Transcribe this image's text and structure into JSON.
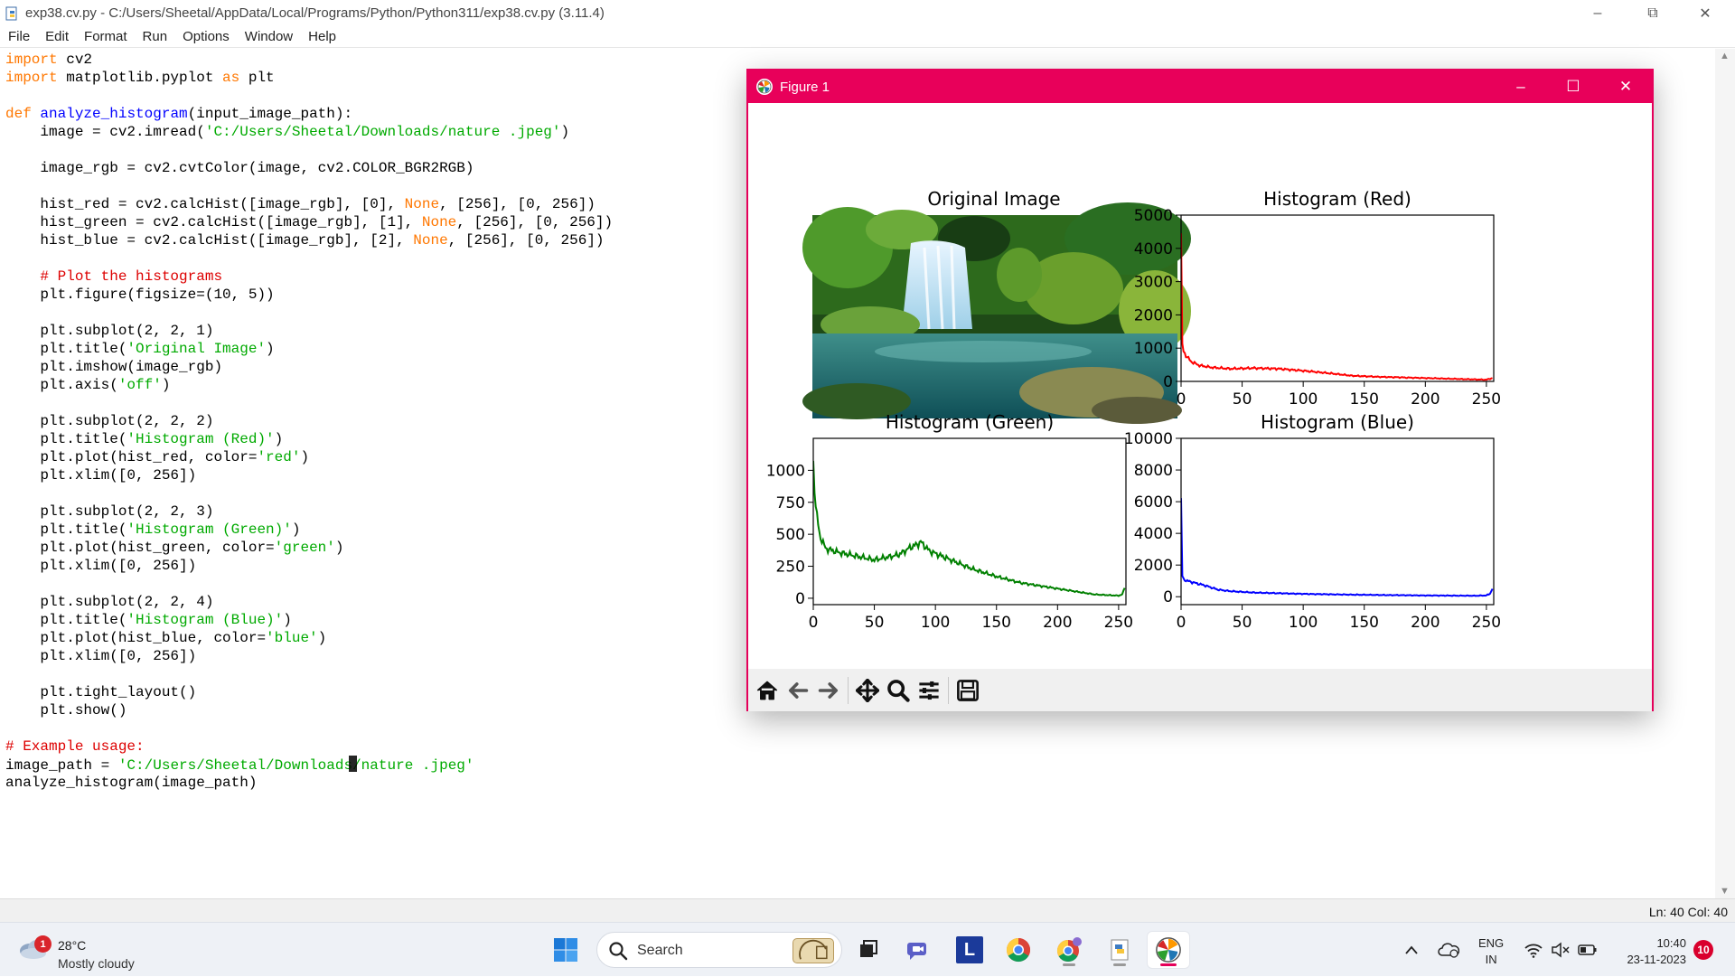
{
  "idle": {
    "title": "exp38.cv.py - C:/Users/Sheetal/AppData/Local/Programs/Python/Python311/exp38.cv.py (3.11.4)",
    "menu": [
      "File",
      "Edit",
      "Format",
      "Run",
      "Options",
      "Window",
      "Help"
    ],
    "code_lines": [
      [
        [
          "kw",
          "import"
        ],
        [
          "t",
          " cv2"
        ]
      ],
      [
        [
          "kw",
          "import"
        ],
        [
          "t",
          " matplotlib.pyplot "
        ],
        [
          "kw",
          "as"
        ],
        [
          "t",
          " plt"
        ]
      ],
      [],
      [
        [
          "kw",
          "def"
        ],
        [
          "t",
          " "
        ],
        [
          "fn",
          "analyze_histogram"
        ],
        [
          "t",
          "(input_image_path):"
        ]
      ],
      [
        [
          "t",
          "    image = cv2.imread("
        ],
        [
          "str",
          "'C:/Users/Sheetal/Downloads/nature .jpeg'"
        ],
        [
          "t",
          ")"
        ]
      ],
      [],
      [
        [
          "t",
          "    image_rgb = cv2.cvtColor(image, cv2.COLOR_BGR2RGB)"
        ]
      ],
      [],
      [
        [
          "t",
          "    hist_red = cv2.calcHist([image_rgb], [0], "
        ],
        [
          "kw",
          "None"
        ],
        [
          "t",
          ", [256], [0, 256])"
        ]
      ],
      [
        [
          "t",
          "    hist_green = cv2.calcHist([image_rgb], [1], "
        ],
        [
          "kw",
          "None"
        ],
        [
          "t",
          ", [256], [0, 256])"
        ]
      ],
      [
        [
          "t",
          "    hist_blue = cv2.calcHist([image_rgb], [2], "
        ],
        [
          "kw",
          "None"
        ],
        [
          "t",
          ", [256], [0, 256])"
        ]
      ],
      [],
      [
        [
          "cm",
          "    # Plot the histograms"
        ]
      ],
      [
        [
          "t",
          "    plt.figure(figsize=(10, 5))"
        ]
      ],
      [],
      [
        [
          "t",
          "    plt.subplot(2, 2, 1)"
        ]
      ],
      [
        [
          "t",
          "    plt.title("
        ],
        [
          "str",
          "'Original Image'"
        ],
        [
          "t",
          ")"
        ]
      ],
      [
        [
          "t",
          "    plt.imshow(image_rgb)"
        ]
      ],
      [
        [
          "t",
          "    plt.axis("
        ],
        [
          "str",
          "'off'"
        ],
        [
          "t",
          ")"
        ]
      ],
      [],
      [
        [
          "t",
          "    plt.subplot(2, 2, 2)"
        ]
      ],
      [
        [
          "t",
          "    plt.title("
        ],
        [
          "str",
          "'Histogram (Red)'"
        ],
        [
          "t",
          ")"
        ]
      ],
      [
        [
          "t",
          "    plt.plot(hist_red, color="
        ],
        [
          "str",
          "'red'"
        ],
        [
          "t",
          ")"
        ]
      ],
      [
        [
          "t",
          "    plt.xlim([0, 256])"
        ]
      ],
      [],
      [
        [
          "t",
          "    plt.subplot(2, 2, 3)"
        ]
      ],
      [
        [
          "t",
          "    plt.title("
        ],
        [
          "str",
          "'Histogram (Green)'"
        ],
        [
          "t",
          ")"
        ]
      ],
      [
        [
          "t",
          "    plt.plot(hist_green, color="
        ],
        [
          "str",
          "'green'"
        ],
        [
          "t",
          ")"
        ]
      ],
      [
        [
          "t",
          "    plt.xlim([0, 256])"
        ]
      ],
      [],
      [
        [
          "t",
          "    plt.subplot(2, 2, 4)"
        ]
      ],
      [
        [
          "t",
          "    plt.title("
        ],
        [
          "str",
          "'Histogram (Blue)'"
        ],
        [
          "t",
          ")"
        ]
      ],
      [
        [
          "t",
          "    plt.plot(hist_blue, color="
        ],
        [
          "str",
          "'blue'"
        ],
        [
          "t",
          ")"
        ]
      ],
      [
        [
          "t",
          "    plt.xlim([0, 256])"
        ]
      ],
      [],
      [
        [
          "t",
          "    plt.tight_layout()"
        ]
      ],
      [
        [
          "t",
          "    plt.show()"
        ]
      ],
      [],
      [
        [
          "cm",
          "# Example usage:"
        ]
      ],
      [
        [
          "t",
          "image_path = "
        ],
        [
          "str",
          "'C:/Users/Sheetal/Downloads"
        ],
        [
          "caret",
          ""
        ],
        [
          "str",
          "/nature .jpeg'"
        ]
      ],
      [
        [
          "t",
          "analyze_histogram(image_path)"
        ]
      ]
    ],
    "status": "Ln: 40   Col: 40"
  },
  "figure": {
    "title": "Figure 1",
    "toolbar": [
      {
        "name": "home-icon",
        "glyph": "home"
      },
      {
        "name": "back-icon",
        "glyph": "back"
      },
      {
        "name": "forward-icon",
        "glyph": "forward"
      },
      {
        "name": "pan-icon",
        "glyph": "pan"
      },
      {
        "name": "zoom-icon",
        "glyph": "zoom"
      },
      {
        "name": "configure-subplots-icon",
        "glyph": "subplots"
      },
      {
        "name": "save-icon",
        "glyph": "save"
      }
    ]
  },
  "chart_data": [
    {
      "type": "image",
      "title": "Original Image",
      "description_visible": false
    },
    {
      "type": "line",
      "title": "Histogram (Red)",
      "color": "#ff0000",
      "xlim": [
        0,
        256
      ],
      "ylim": [
        0,
        5000
      ],
      "xticks": [
        0,
        50,
        100,
        150,
        200,
        250
      ],
      "yticks": [
        0,
        1000,
        2000,
        3000,
        4000,
        5000
      ],
      "ytick_labels": [
        "0",
        "1000",
        "2000",
        "3000",
        "4000",
        "5000"
      ],
      "series": [
        {
          "x": [
            0,
            1,
            2,
            4,
            8,
            15,
            25,
            40,
            60,
            80,
            100,
            120,
            140,
            160,
            180,
            200,
            220,
            240,
            250,
            255
          ],
          "y": [
            4300,
            1100,
            900,
            780,
            600,
            480,
            420,
            380,
            400,
            380,
            320,
            250,
            170,
            140,
            120,
            100,
            80,
            60,
            50,
            100
          ]
        }
      ]
    },
    {
      "type": "line",
      "title": "Histogram (Green)",
      "color": "#008000",
      "xlim": [
        0,
        256
      ],
      "ylim": [
        -50,
        1250
      ],
      "xticks": [
        0,
        50,
        100,
        150,
        200,
        250
      ],
      "yticks": [
        0,
        250,
        500,
        750,
        1000
      ],
      "ytick_labels": [
        "0",
        "250",
        "500",
        "750",
        "1000"
      ],
      "series": [
        {
          "x": [
            0,
            2,
            5,
            10,
            20,
            30,
            40,
            50,
            60,
            70,
            80,
            85,
            88,
            95,
            110,
            130,
            150,
            170,
            190,
            210,
            230,
            250,
            253,
            255
          ],
          "y": [
            1050,
            720,
            500,
            390,
            360,
            340,
            320,
            300,
            320,
            340,
            400,
            420,
            440,
            370,
            310,
            230,
            170,
            120,
            90,
            60,
            30,
            20,
            30,
            80
          ]
        }
      ]
    },
    {
      "type": "line",
      "title": "Histogram (Blue)",
      "color": "#0000ff",
      "xlim": [
        0,
        256
      ],
      "ylim": [
        -500,
        10000
      ],
      "xticks": [
        0,
        50,
        100,
        150,
        200,
        250
      ],
      "yticks": [
        0,
        2000,
        4000,
        6000,
        8000,
        10000
      ],
      "ytick_labels": [
        "0",
        "2000",
        "4000",
        "6000",
        "8000",
        "10000"
      ],
      "series": [
        {
          "x": [
            0,
            1,
            2,
            5,
            10,
            20,
            30,
            40,
            60,
            80,
            100,
            130,
            160,
            200,
            240,
            250,
            253,
            255
          ],
          "y": [
            6100,
            1300,
            1100,
            1000,
            900,
            700,
            450,
            350,
            260,
            220,
            180,
            140,
            110,
            80,
            60,
            80,
            200,
            500
          ]
        }
      ]
    }
  ],
  "taskbar": {
    "weather_temp": "28°C",
    "weather_condition": "Mostly cloudy",
    "weather_badge": "1",
    "search_label": "Search",
    "lang_line1": "ENG",
    "lang_line2": "IN",
    "time": "10:40",
    "date": "23-11-2023",
    "notification_count": "10",
    "pinned_app_letter": "L"
  }
}
